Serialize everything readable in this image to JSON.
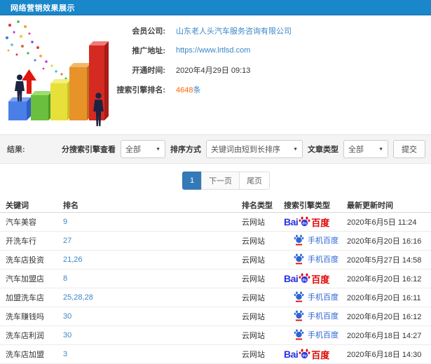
{
  "titlebar": {
    "title": "网络营销效果展示"
  },
  "info": {
    "rows": [
      {
        "label": "会员公司:",
        "value": "山东老人头汽车服务咨询有限公司"
      },
      {
        "label": "推广地址:",
        "value": "https://www.lrtlsd.com"
      },
      {
        "label": "开通时间:",
        "value": "2020年4月29日 09:13"
      },
      {
        "label": "搜索引擎排名:",
        "value": "4648",
        "suffix": "条"
      }
    ]
  },
  "filter": {
    "result_label": "结果:",
    "engine_label": "分搜索引擎查看",
    "engine_value": "全部",
    "sort_label": "排序方式",
    "sort_value": "关键词由短到长排序",
    "article_label": "文章类型",
    "article_value": "全部",
    "submit_label": "提交"
  },
  "pagination": {
    "current": "1",
    "next_label": "下一页",
    "last_label": "尾页"
  },
  "table": {
    "headers": {
      "keyword": "关键词",
      "rank": "排名",
      "rank_type": "排名类型",
      "engine_type": "搜索引擎类型",
      "updated": "最新更新时间"
    },
    "rows": [
      {
        "keyword": "汽车美容",
        "rank": "9",
        "rank_type": "云网站",
        "engine": "baidu",
        "updated": "2020年6月5日 11:24"
      },
      {
        "keyword": "开洗车行",
        "rank": "27",
        "rank_type": "云网站",
        "engine": "mobile-baidu",
        "updated": "2020年6月20日 16:16"
      },
      {
        "keyword": "洗车店投资",
        "rank": "21,26",
        "rank_type": "云网站",
        "engine": "mobile-baidu",
        "updated": "2020年5月27日 14:58"
      },
      {
        "keyword": "汽车加盟店",
        "rank": "8",
        "rank_type": "云网站",
        "engine": "baidu",
        "updated": "2020年6月20日 16:12"
      },
      {
        "keyword": "加盟洗车店",
        "rank": "25,28,28",
        "rank_type": "云网站",
        "engine": "mobile-baidu",
        "updated": "2020年6月20日 16:11"
      },
      {
        "keyword": "洗车赚钱吗",
        "rank": "30",
        "rank_type": "云网站",
        "engine": "mobile-baidu",
        "updated": "2020年6月20日 16:12"
      },
      {
        "keyword": "洗车店利润",
        "rank": "30",
        "rank_type": "云网站",
        "engine": "mobile-baidu",
        "updated": "2020年6月18日 14:27"
      },
      {
        "keyword": "洗车店加盟",
        "rank": "3",
        "rank_type": "云网站",
        "engine": "baidu",
        "updated": "2020年6月18日 14:30"
      }
    ]
  },
  "logos": {
    "baidu": {
      "bai": "Bai",
      "du": "du",
      "cn": "百度"
    },
    "mobile_baidu": {
      "label": "手机百度"
    }
  },
  "colors": {
    "header_bg": "#1987ca",
    "link": "#3a87c8",
    "highlight": "#ff6600",
    "active_page_bg": "#337ab7",
    "baidu_blue": "#2932e1",
    "baidu_red": "#e10602"
  }
}
